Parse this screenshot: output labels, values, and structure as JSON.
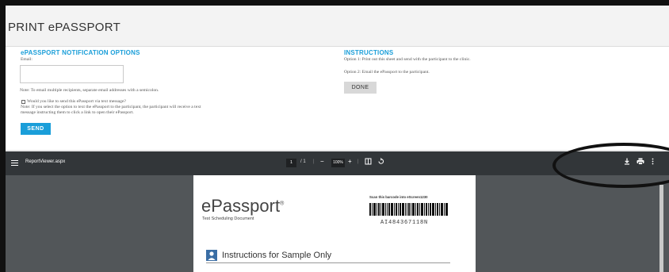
{
  "header": {
    "title": "PRINT ePASSPORT"
  },
  "notification": {
    "title": "ePASSPORT NOTIFICATION OPTIONS",
    "email_label": "Email:",
    "email_value": "",
    "note_multi": "Note: To email multiple recipients, separate email addresses with a semicolon.",
    "text_option": "Would you like to send this ePassport via text message?",
    "text_note_1": "Note: If you select the option to text the ePassport to the participant, the participant will receive a text",
    "text_note_2": "message instructing them to click a link to open their ePassport.",
    "send_label": "SEND"
  },
  "instructions": {
    "title": "INSTRUCTIONS",
    "option1": "Option 1: Print out this sheet and send with the participant to the clinic.",
    "option2": "Option 2: Email the ePassport to the participant.",
    "done_label": "DONE"
  },
  "viewer": {
    "file_name": "ReportViewer.aspx",
    "page_current": "1",
    "page_total": "/ 1",
    "zoom": "100%",
    "icons": [
      "menu-icon",
      "zoom-out-icon",
      "zoom-in-icon",
      "fit-page-icon",
      "rotate-icon",
      "download-icon",
      "print-icon",
      "more-icon"
    ]
  },
  "document": {
    "logo": "ePassport",
    "logo_mark": "®",
    "subtitle": "Test Scheduling Document",
    "scan_text": "Scan this barcode into eScreen1230",
    "code": "AI484367118N",
    "section_title": "Instructions for Sample Only"
  },
  "colors": {
    "accent": "#1a9ed9",
    "toolbar": "#323639",
    "viewer_bg": "#525659"
  }
}
